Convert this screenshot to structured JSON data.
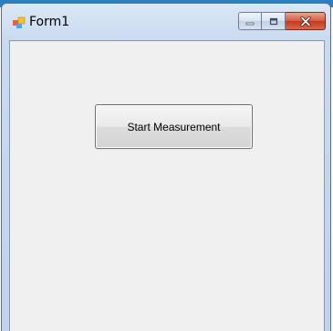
{
  "window": {
    "title": "Form1"
  },
  "caption_buttons": {
    "minimize_icon": "minimize-icon",
    "maximize_icon": "maximize-icon",
    "close_icon": "close-icon"
  },
  "form": {
    "start_button_label": "Start Measurement"
  },
  "colors": {
    "desktop_accent": "#2a7fc6",
    "close_button": "#c94a2c",
    "client_background": "#f0f0f0"
  }
}
